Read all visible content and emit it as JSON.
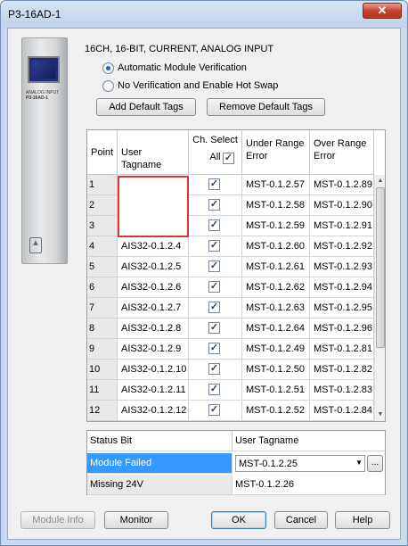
{
  "window": {
    "title": "P3-16AD-1",
    "close_glyph": "✕"
  },
  "module": {
    "image_label": "P3-16AD-1",
    "image_sublabel": "ANALOG INPUT",
    "description": "16CH, 16-BIT, CURRENT, ANALOG INPUT",
    "icons": {
      "logo": "triangle-logo-icon"
    }
  },
  "options": {
    "auto_verify_label": "Automatic Module Verification",
    "auto_verify_selected": true,
    "hot_swap_label": "No Verification and Enable Hot Swap",
    "hot_swap_selected": false
  },
  "toolbar": {
    "add_default_tags": "Add Default Tags",
    "remove_default_tags": "Remove Default Tags"
  },
  "table": {
    "headers": {
      "point": "Point",
      "user_tagname": "User Tagname",
      "ch_select": "Ch. Select",
      "ch_select_all": "All",
      "under_range": "Under Range Error",
      "over_range": "Over Range Error"
    },
    "rows": [
      {
        "point": "1",
        "tag": "",
        "checked": true,
        "under": "MST-0.1.2.57",
        "over": "MST-0.1.2.89"
      },
      {
        "point": "2",
        "tag": "",
        "checked": true,
        "under": "MST-0.1.2.58",
        "over": "MST-0.1.2.90"
      },
      {
        "point": "3",
        "tag": "",
        "checked": true,
        "under": "MST-0.1.2.59",
        "over": "MST-0.1.2.91"
      },
      {
        "point": "4",
        "tag": "AIS32-0.1.2.4",
        "checked": true,
        "under": "MST-0.1.2.60",
        "over": "MST-0.1.2.92"
      },
      {
        "point": "5",
        "tag": "AIS32-0.1.2.5",
        "checked": true,
        "under": "MST-0.1.2.61",
        "over": "MST-0.1.2.93"
      },
      {
        "point": "6",
        "tag": "AIS32-0.1.2.6",
        "checked": true,
        "under": "MST-0.1.2.62",
        "over": "MST-0.1.2.94"
      },
      {
        "point": "7",
        "tag": "AIS32-0.1.2.7",
        "checked": true,
        "under": "MST-0.1.2.63",
        "over": "MST-0.1.2.95"
      },
      {
        "point": "8",
        "tag": "AIS32-0.1.2.8",
        "checked": true,
        "under": "MST-0.1.2.64",
        "over": "MST-0.1.2.96"
      },
      {
        "point": "9",
        "tag": "AIS32-0.1.2.9",
        "checked": true,
        "under": "MST-0.1.2.49",
        "over": "MST-0.1.2.81"
      },
      {
        "point": "10",
        "tag": "AIS32-0.1.2.10",
        "checked": true,
        "under": "MST-0.1.2.50",
        "over": "MST-0.1.2.82"
      },
      {
        "point": "11",
        "tag": "AIS32-0.1.2.11",
        "checked": true,
        "under": "MST-0.1.2.51",
        "over": "MST-0.1.2.83"
      },
      {
        "point": "12",
        "tag": "AIS32-0.1.2.12",
        "checked": true,
        "under": "MST-0.1.2.52",
        "over": "MST-0.1.2.84"
      }
    ]
  },
  "status_bits": {
    "headers": {
      "status_bit": "Status Bit",
      "user_tagname": "User Tagname"
    },
    "rows": [
      {
        "name": "Module Failed",
        "tag": "MST-0.1.2.25",
        "selected": true
      },
      {
        "name": "Missing 24V",
        "tag": "MST-0.1.2.26",
        "selected": false
      }
    ],
    "browse_label": "..."
  },
  "footer": {
    "module_info": "Module Info",
    "monitor": "Monitor",
    "ok": "OK",
    "cancel": "Cancel",
    "help": "Help"
  },
  "colors": {
    "selection": "#3399ff",
    "error_box": "#e03030",
    "window_frame": "#c9daf0"
  }
}
